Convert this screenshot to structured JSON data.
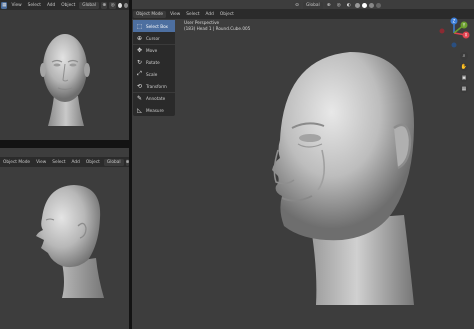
{
  "top_left_header": {
    "menus": [
      "View",
      "Select",
      "Add",
      "Object"
    ],
    "transform_label": "Global"
  },
  "bottom_left_header": {
    "mode": "Object Mode",
    "menus": [
      "View",
      "Select",
      "Add",
      "Object"
    ],
    "transform_label": "Global"
  },
  "main_header": {
    "mode": "Object Mode",
    "menus": [
      "View",
      "Select",
      "Add",
      "Object"
    ],
    "transform_label": "Global"
  },
  "toolbar": {
    "items": [
      {
        "label": "Select Box",
        "icon": "select-box-icon"
      },
      {
        "label": "Cursor",
        "icon": "cursor-icon"
      },
      {
        "label": "Move",
        "icon": "move-icon"
      },
      {
        "label": "Rotate",
        "icon": "rotate-icon"
      },
      {
        "label": "Scale",
        "icon": "scale-icon"
      },
      {
        "label": "Transform",
        "icon": "transform-icon"
      },
      {
        "label": "Annotate",
        "icon": "annotate-icon"
      },
      {
        "label": "Measure",
        "icon": "measure-icon"
      }
    ]
  },
  "viewport_info": {
    "line1": "User Perspective",
    "line2": "(183) Head 1 | Round.Cube.005"
  },
  "gizmo": {
    "x": "X",
    "y": "Y",
    "z": "Z"
  },
  "colors": {
    "background": "#1c1c1c",
    "header": "#2b2b2b",
    "viewport": "#3d3d3d",
    "selected_tool": "#4d6fa0",
    "axis_x": "#e0424f",
    "axis_y": "#6b9e2e",
    "axis_z": "#3d7ed8"
  }
}
